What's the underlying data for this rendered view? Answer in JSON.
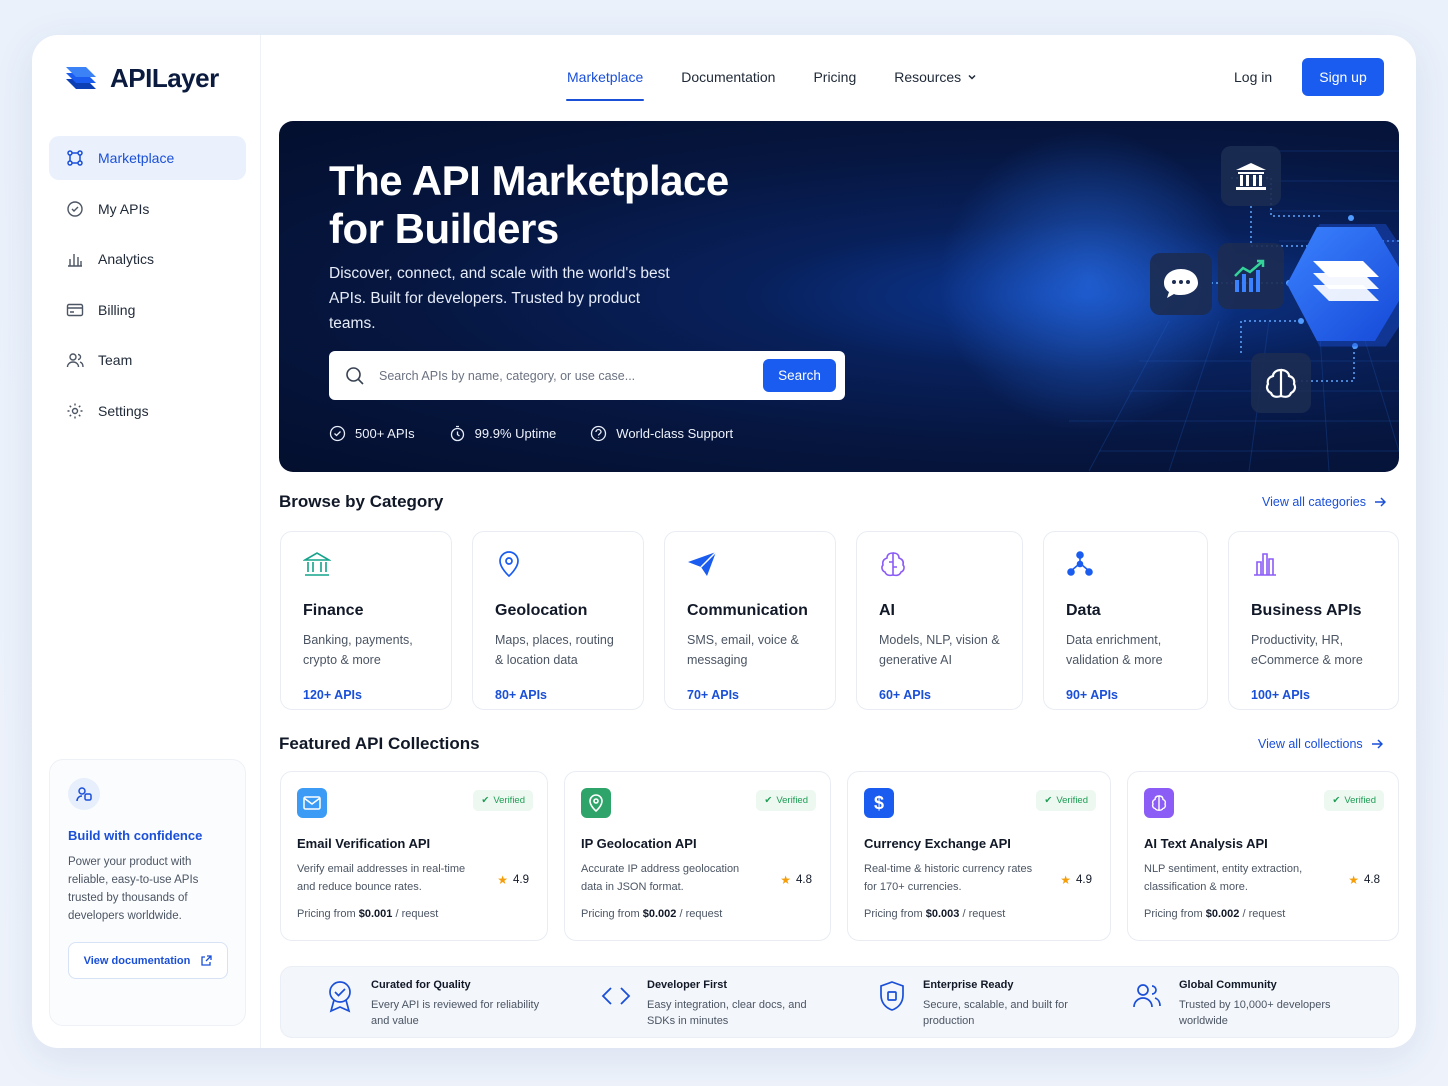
{
  "brand": {
    "name": "APILayer",
    "accent": "#1a5cf0"
  },
  "sidebar": {
    "items": [
      {
        "label": "Marketplace",
        "icon": "marketplace-icon",
        "active": true
      },
      {
        "label": "My APIs",
        "icon": "api-badge-icon"
      },
      {
        "label": "Analytics",
        "icon": "bar-chart-icon"
      },
      {
        "label": "Billing",
        "icon": "card-icon"
      },
      {
        "label": "Team",
        "icon": "team-icon"
      },
      {
        "label": "Settings",
        "icon": "gear-icon"
      }
    ],
    "promo": {
      "title": "Build with confidence",
      "text": "Power your product with reliable, easy-to-use APIs trusted by thousands of developers worldwide.",
      "button": "View documentation"
    }
  },
  "header": {
    "nav": [
      "Marketplace",
      "Documentation",
      "Pricing",
      "Resources"
    ],
    "login": "Log in",
    "signup": "Sign up"
  },
  "hero": {
    "title": "The API Marketplace for Builders",
    "subtitle": "Discover, connect, and scale with the world's best APIs. Built for developers. Trusted by product teams.",
    "search_placeholder": "Search APIs by name, category, or use case...",
    "search_button": "Search",
    "stats": [
      "500+ APIs",
      "99.9% Uptime",
      "World-class Support"
    ]
  },
  "categories": {
    "title": "Browse by Category",
    "view_all": "View all categories",
    "items": [
      {
        "name": "Finance",
        "desc": "Banking, payments, crypto & more",
        "count": "120+ APIs",
        "icon": "bank-icon"
      },
      {
        "name": "Geolocation",
        "desc": "Maps, places, routing & location data",
        "count": "80+ APIs",
        "icon": "location-pin-icon"
      },
      {
        "name": "Communication",
        "desc": "SMS, email, voice & messaging",
        "count": "70+ APIs",
        "icon": "paper-plane-icon"
      },
      {
        "name": "AI",
        "desc": "Models, NLP, vision & generative AI",
        "count": "60+ APIs",
        "icon": "brain-icon"
      },
      {
        "name": "Data",
        "desc": "Data enrichment, validation & more",
        "count": "90+ APIs",
        "icon": "data-nodes-icon"
      },
      {
        "name": "Business APIs",
        "desc": "Productivity, HR, eCommerce & more",
        "count": "100+ APIs",
        "icon": "buildings-icon"
      }
    ]
  },
  "featured": {
    "title": "Featured API Collections",
    "view_all": "View all collections",
    "badge": "Verified",
    "price_prefix": "Pricing from",
    "price_suffix": "/ request",
    "items": [
      {
        "name": "Email Verification API",
        "desc": "Verify email addresses in real-time and reduce bounce rates.",
        "rating": "4.9",
        "price": "$0.001",
        "icon": "mail-icon",
        "color": "#3b9bf5"
      },
      {
        "name": "IP Geolocation API",
        "desc": "Accurate IP address geolocation data in JSON format.",
        "rating": "4.8",
        "price": "$0.002",
        "icon": "location-pin-icon",
        "color": "#2ea46a"
      },
      {
        "name": "Currency Exchange API",
        "desc": "Real-time & historic currency rates for 170+ currencies.",
        "rating": "4.9",
        "price": "$0.003",
        "icon": "dollar-icon",
        "color": "#1a5cf0"
      },
      {
        "name": "AI Text Analysis API",
        "desc": "NLP sentiment, entity extraction, classification & more.",
        "rating": "4.8",
        "price": "$0.002",
        "icon": "brain-icon",
        "color": "#8b5cf6"
      }
    ]
  },
  "benefits": [
    {
      "title": "Curated for Quality",
      "text": "Every API is reviewed for reliability and value",
      "icon": "award-icon"
    },
    {
      "title": "Developer First",
      "text": "Easy integration, clear docs, and SDKs in minutes",
      "icon": "code-icon"
    },
    {
      "title": "Enterprise Ready",
      "text": "Secure, scalable, and built for production",
      "icon": "shield-icon"
    },
    {
      "title": "Global Community",
      "text": "Trusted by 10,000+ developers worldwide",
      "icon": "users-icon"
    }
  ]
}
